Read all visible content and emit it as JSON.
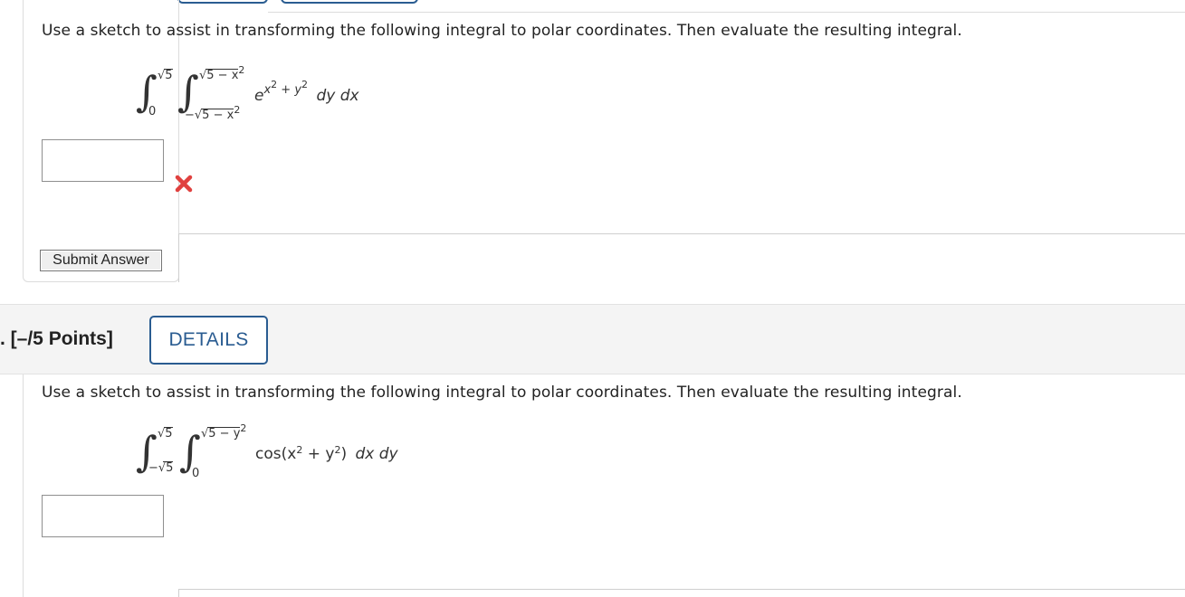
{
  "question1": {
    "prompt": "Use a sketch to assist in transforming the following integral to polar coordinates. Then evaluate the resulting integral.",
    "outer_upper": "√5",
    "outer_lower": "0",
    "inner_upper": "√5 − x",
    "inner_lower": "−√5 − x",
    "square": "2",
    "integrand_base": "e",
    "integrand_exp_x": "x",
    "integrand_exp_plus": " + ",
    "integrand_exp_y": "y",
    "differentials": "dy dx",
    "answer_value": "",
    "status": "incorrect",
    "status_icon": "wrong-x-icon",
    "submit_label": "Submit Answer"
  },
  "question2": {
    "points_label": ". [–/5 Points]",
    "details_label": "DETAILS",
    "prompt": "Use a sketch to assist in transforming the following integral to polar coordinates. Then evaluate the resulting integral.",
    "outer_upper": "√5",
    "outer_lower": "−√5",
    "inner_upper": "√5 − y",
    "inner_lower": "0",
    "square": "2",
    "integrand_pre": "cos(x",
    "integrand_mid": " + y",
    "integrand_post": ")",
    "differentials": "dx dy",
    "answer_value": ""
  },
  "colors": {
    "accent": "#2a5c91",
    "error": "#e0413f",
    "header_bg": "#f4f4f4"
  }
}
